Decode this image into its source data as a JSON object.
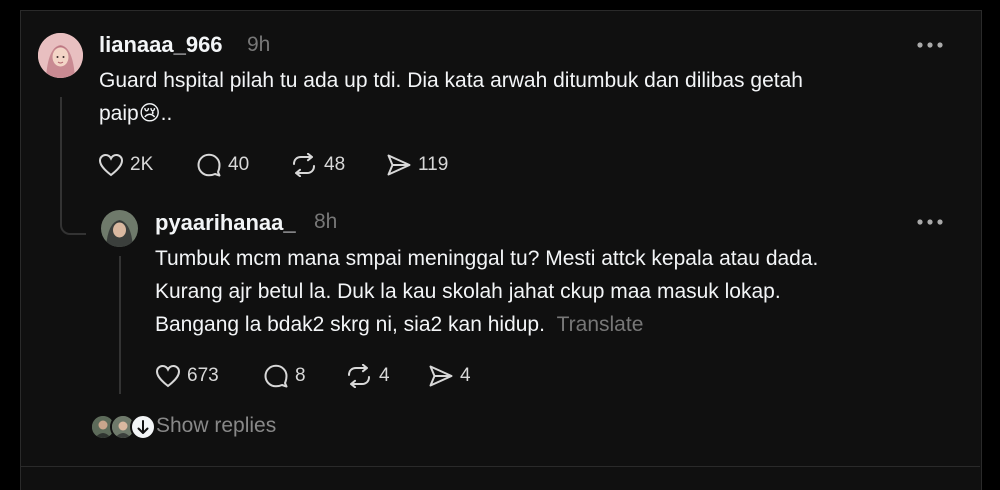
{
  "post": {
    "username": "lianaaa_966",
    "time": "9h",
    "more_icon": "more-horizontal-icon",
    "text_line1": "Guard hspital pilah tu ada up tdi. Dia kata arwah ditumbuk dan dilibas getah",
    "text_line2": "paip",
    "emoji": "😢",
    "text_suffix": "..",
    "likes": "2K",
    "comments": "40",
    "reposts": "48",
    "shares": "119"
  },
  "reply": {
    "username": "pyaarihanaa_",
    "time": "8h",
    "more_icon": "more-horizontal-icon",
    "text_line1": "Tumbuk mcm mana smpai meninggal tu? Mesti attck kepala atau dada.",
    "text_line2": "Kurang ajr betul la. Duk la kau skolah jahat ckup maa masuk lokap.",
    "text_line3": "Bangang la bdak2 skrg ni, sia2 kan hidup.",
    "translate_label": "Translate",
    "likes": "673",
    "comments": "8",
    "reposts": "4",
    "shares": "4"
  },
  "show_replies_label": "Show replies",
  "icons": {
    "like": "heart-icon",
    "comment": "comment-bubble-icon",
    "repost": "repost-icon",
    "share": "send-icon"
  },
  "colors": {
    "background": "#101010",
    "text": "#f3f5f7",
    "muted": "#777777",
    "thread_line": "#333333"
  }
}
